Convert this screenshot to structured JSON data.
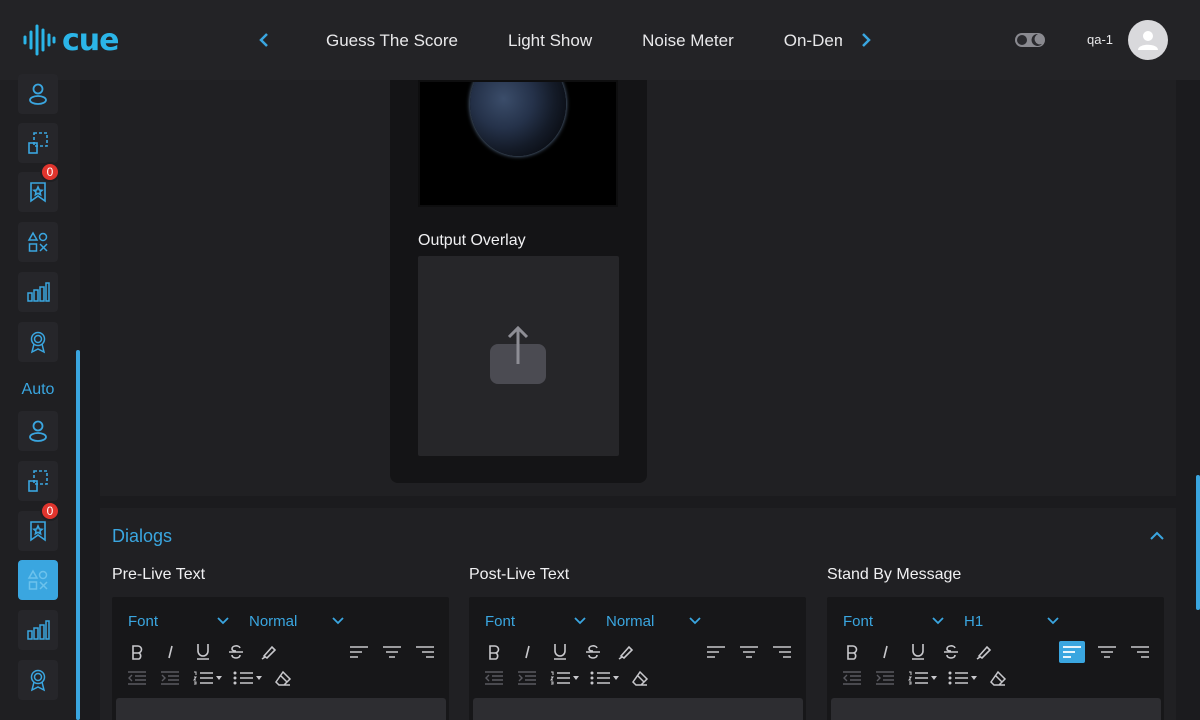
{
  "app": {
    "logo_text": "cue"
  },
  "nav": {
    "tabs": [
      "Guess The Score",
      "Light Show",
      "Noise Meter",
      "On-Demand"
    ]
  },
  "user": {
    "name": "qa-1"
  },
  "sidebar": {
    "section_label": "Auto",
    "badges": [
      "0",
      "0"
    ]
  },
  "media": {
    "output_overlay_label": "Output Overlay"
  },
  "dialogs": {
    "title": "Dialogs",
    "editors": [
      {
        "title": "Pre-Live Text",
        "font": "Font",
        "size": "Normal"
      },
      {
        "title": "Post-Live Text",
        "font": "Font",
        "size": "Normal"
      },
      {
        "title": "Stand By Message",
        "font": "Font",
        "size": "H1"
      }
    ]
  },
  "colors": {
    "accent": "#3aa6e0",
    "badge": "#e0342d",
    "background": "#1b1b1e"
  }
}
